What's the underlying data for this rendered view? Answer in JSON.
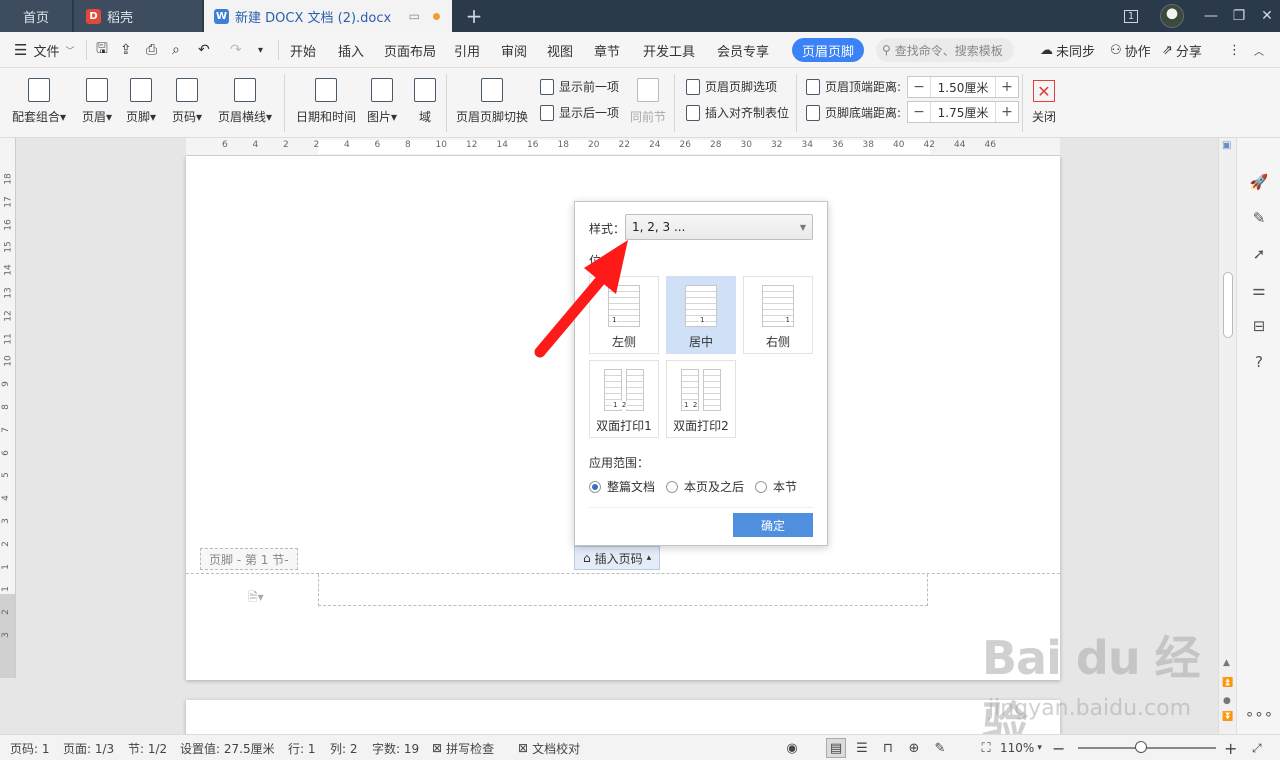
{
  "tabs": {
    "home": "首页",
    "daoke": "稻壳",
    "doc": "新建 DOCX 文档 (2).docx",
    "badge": "1"
  },
  "menu": {
    "file": "文件",
    "items": [
      "开始",
      "插入",
      "页面布局",
      "引用",
      "审阅",
      "视图",
      "章节",
      "开发工具",
      "会员专享"
    ],
    "active": "页眉页脚",
    "search_placeholder": "查找命令、搜索模板",
    "sync": "未同步",
    "collab": "协作",
    "share": "分享"
  },
  "ribbon": {
    "combo": "配套组合",
    "header": "页眉",
    "footer": "页脚",
    "pagenum": "页码",
    "header_line": "页眉横线",
    "datetime": "日期和时间",
    "picture": "图片",
    "field": "域",
    "switch": "页眉页脚切换",
    "show_prev": "显示前一项",
    "show_next": "显示后一项",
    "same_prev": "同前节",
    "hf_options": "页眉页脚选项",
    "insert_align_tab": "插入对齐制表位",
    "top_dist_label": "页眉顶端距离:",
    "top_dist_value": "1.50厘米",
    "bottom_dist_label": "页脚底端距离:",
    "bottom_dist_value": "1.75厘米",
    "close": "关闭"
  },
  "ruler": {
    "h_ticks": [
      "6",
      "4",
      "2",
      "2",
      "4",
      "6",
      "8",
      "10",
      "12",
      "14",
      "16",
      "18",
      "20",
      "22",
      "24",
      "26",
      "28",
      "30",
      "32",
      "34",
      "36",
      "38",
      "40",
      "42",
      "44",
      "46"
    ],
    "v_ticks": [
      "18",
      "17",
      "16",
      "15",
      "14",
      "13",
      "12",
      "11",
      "10",
      "9",
      "8",
      "7",
      "6",
      "5",
      "4",
      "3",
      "2",
      "1",
      "1",
      "2",
      "3"
    ]
  },
  "document": {
    "footer_label": "页脚  - 第 1 节-",
    "insert_page_number": "插入页码"
  },
  "popup": {
    "style_label": "样式：",
    "style_value": "1, 2, 3 ...",
    "position_label": "位",
    "options": [
      {
        "label": "左侧",
        "num": "1",
        "selected": false
      },
      {
        "label": "居中",
        "num": "1",
        "selected": true
      },
      {
        "label": "右侧",
        "num": "1",
        "selected": false
      },
      {
        "label": "双面打印1",
        "num": "1  2",
        "selected": false
      },
      {
        "label": "双面打印2",
        "num": "1  2",
        "selected": false
      }
    ],
    "scope_label": "应用范围：",
    "scope_options": [
      {
        "label": "整篇文档",
        "checked": true
      },
      {
        "label": "本页及之后",
        "checked": false
      },
      {
        "label": "本节",
        "checked": false
      }
    ],
    "ok": "确定"
  },
  "watermark": {
    "brand": "Bai du 经验",
    "url": "jingyan.baidu.com"
  },
  "statusbar": {
    "page_code": "页码: 1",
    "page": "页面: 1/3",
    "section": "节: 1/2",
    "setting": "设置值: 27.5厘米",
    "row": "行: 1",
    "col": "列: 2",
    "words": "字数: 19",
    "spell": "拼写检查",
    "proof": "文档校对",
    "zoom": "110%",
    "zoom_level": 0.46
  },
  "colors": {
    "tabbar": "#2b3a4a",
    "accent": "#3b82f6",
    "ok_button": "#4f8fde",
    "arrow": "#ff1a1a"
  }
}
